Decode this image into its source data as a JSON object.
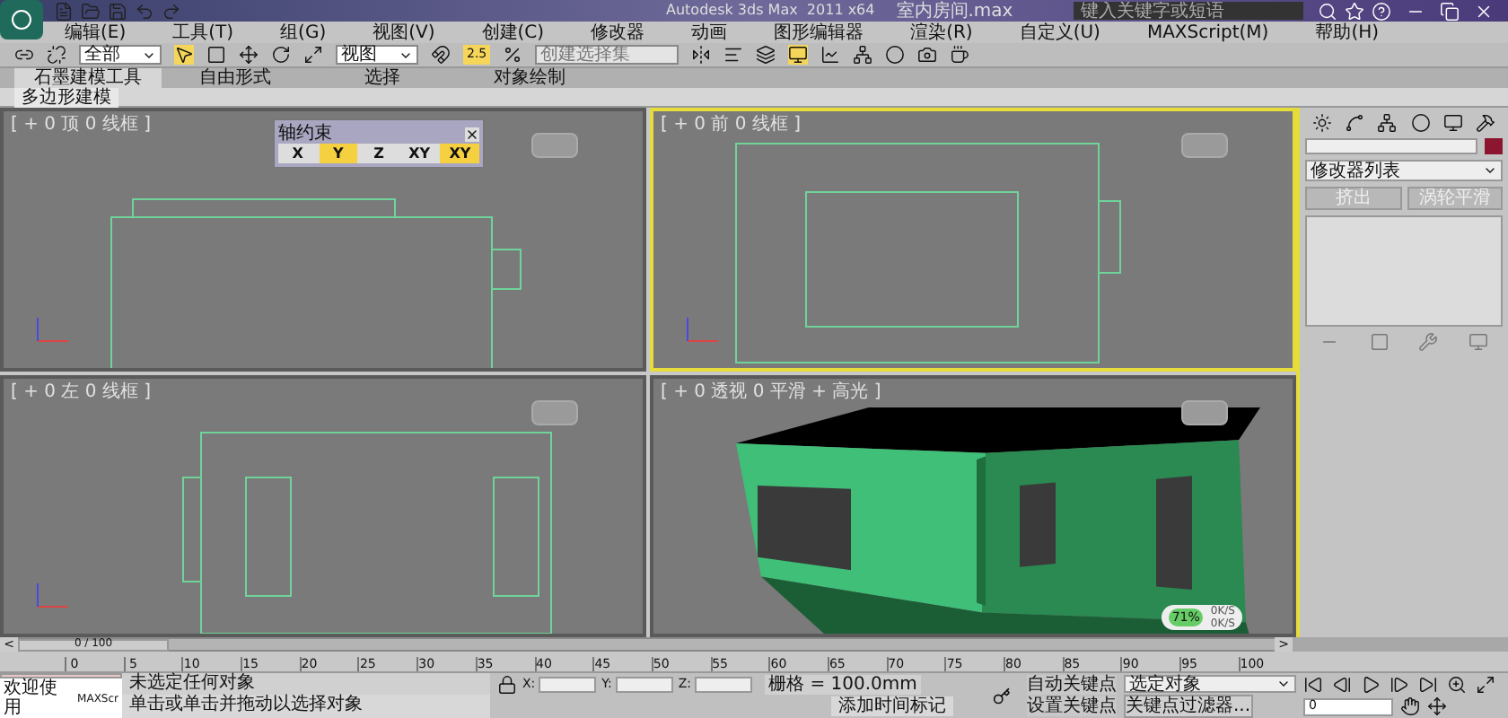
{
  "title_bar": {
    "title": "Autodesk 3ds Max  2011 x64",
    "file": "室内房间.max",
    "search": {
      "placeholder": "键入关键字或短语"
    }
  },
  "menu": [
    "编辑(E)",
    "工具(T)",
    "组(G)",
    "视图(V)",
    "创建(C)",
    "修改器",
    "动画",
    "图形编辑器",
    "渲染(R)",
    "自定义(U)",
    "MAXScript(M)",
    "帮助(H)"
  ],
  "toolbar": {
    "selection_filter": "全部",
    "reference_coord": "视图",
    "snap_value": "2.5",
    "named_selection": {
      "placeholder": "创建选择集"
    }
  },
  "ribbon": {
    "tabs": [
      {
        "label": "石墨建模工具",
        "selected": true
      },
      {
        "label": "自由形式",
        "selected": false
      },
      {
        "label": "选择",
        "selected": false
      },
      {
        "label": "对象绘制",
        "selected": false
      }
    ],
    "panel": "多边形建模"
  },
  "axis_constraints": {
    "title": "轴约束",
    "buttons": [
      {
        "label": "X",
        "selected": false
      },
      {
        "label": "Y",
        "selected": true
      },
      {
        "label": "Z",
        "selected": false
      },
      {
        "label": "XY",
        "selected": false
      },
      {
        "label": "XY",
        "selected": true
      }
    ]
  },
  "viewports": [
    {
      "kind": "top",
      "label": "[ + 0 顶 0 线框 ]",
      "active": false
    },
    {
      "kind": "front",
      "label": "[ + 0 前 0 线框 ]",
      "active": true
    },
    {
      "kind": "left",
      "label": "[ + 0 左 0 线框 ]",
      "active": false
    },
    {
      "kind": "perspective",
      "label": "[ + 0 透视 0 平滑 + 高光 ]",
      "active": false
    }
  ],
  "perspective_stats": {
    "percent": "71%",
    "rates": [
      "0K/S",
      "0K/S"
    ]
  },
  "command_panel": {
    "modifier_list": "修改器列表",
    "buttons": [
      "挤出",
      "涡轮平滑"
    ]
  },
  "timeline": {
    "position": "0 / 100",
    "level": 0,
    "prev": "<",
    "next": ">",
    "ticks": [
      "0",
      "5",
      "10",
      "15",
      "20",
      "25",
      "30",
      "35",
      "40",
      "45",
      "50",
      "55",
      "60",
      "65",
      "70",
      "75",
      "80",
      "85",
      "90",
      "95",
      "100"
    ]
  },
  "status": {
    "welcome": "欢迎使用",
    "maxscript": "MAXScr",
    "selection": "未选定任何对象",
    "prompt": "单击或单击并拖动以选择对象",
    "coords": [
      "X:",
      "Y:",
      "Z:"
    ],
    "grid": "栅格 = 100.0mm",
    "add_time_tag": "添加时间标记",
    "auto_key": "自动关键点",
    "set_key": "设置关键点",
    "key_mode": "选定对象",
    "key_filters": "关键点过滤器...",
    "frame": "0"
  }
}
